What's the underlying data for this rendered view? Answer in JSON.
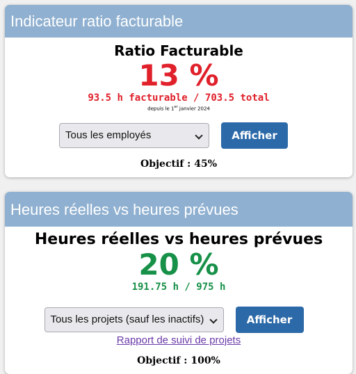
{
  "billable_card": {
    "header": "Indicateur ratio facturable",
    "title": "Ratio Facturable",
    "value": "13 %",
    "detail": "93.5 h facturable / 703.5 total",
    "since_prefix": "depuis le 1",
    "since_sup": "er",
    "since_suffix": " janvier 2024",
    "select_value": "Tous les employés",
    "button_label": "Afficher",
    "objective": "Objectif : 45%"
  },
  "hours_card": {
    "header": "Heures réelles vs heures prévues",
    "title": "Heures réelles vs heures prévues",
    "value": "20 %",
    "detail": "191.75 h / 975 h",
    "select_value": "Tous les projets (sauf les inactifs)",
    "button_label": "Afficher",
    "link_label": "Rapport de suivi de projets",
    "objective": "Objectif : 100%"
  },
  "colors": {
    "header_bg": "#8fb0d0",
    "billable_value": "#e0202a",
    "hours_value": "#179048",
    "button_bg": "#2b69a8",
    "link": "#6a3aa8"
  },
  "icons": [
    "chevron-down-icon"
  ]
}
